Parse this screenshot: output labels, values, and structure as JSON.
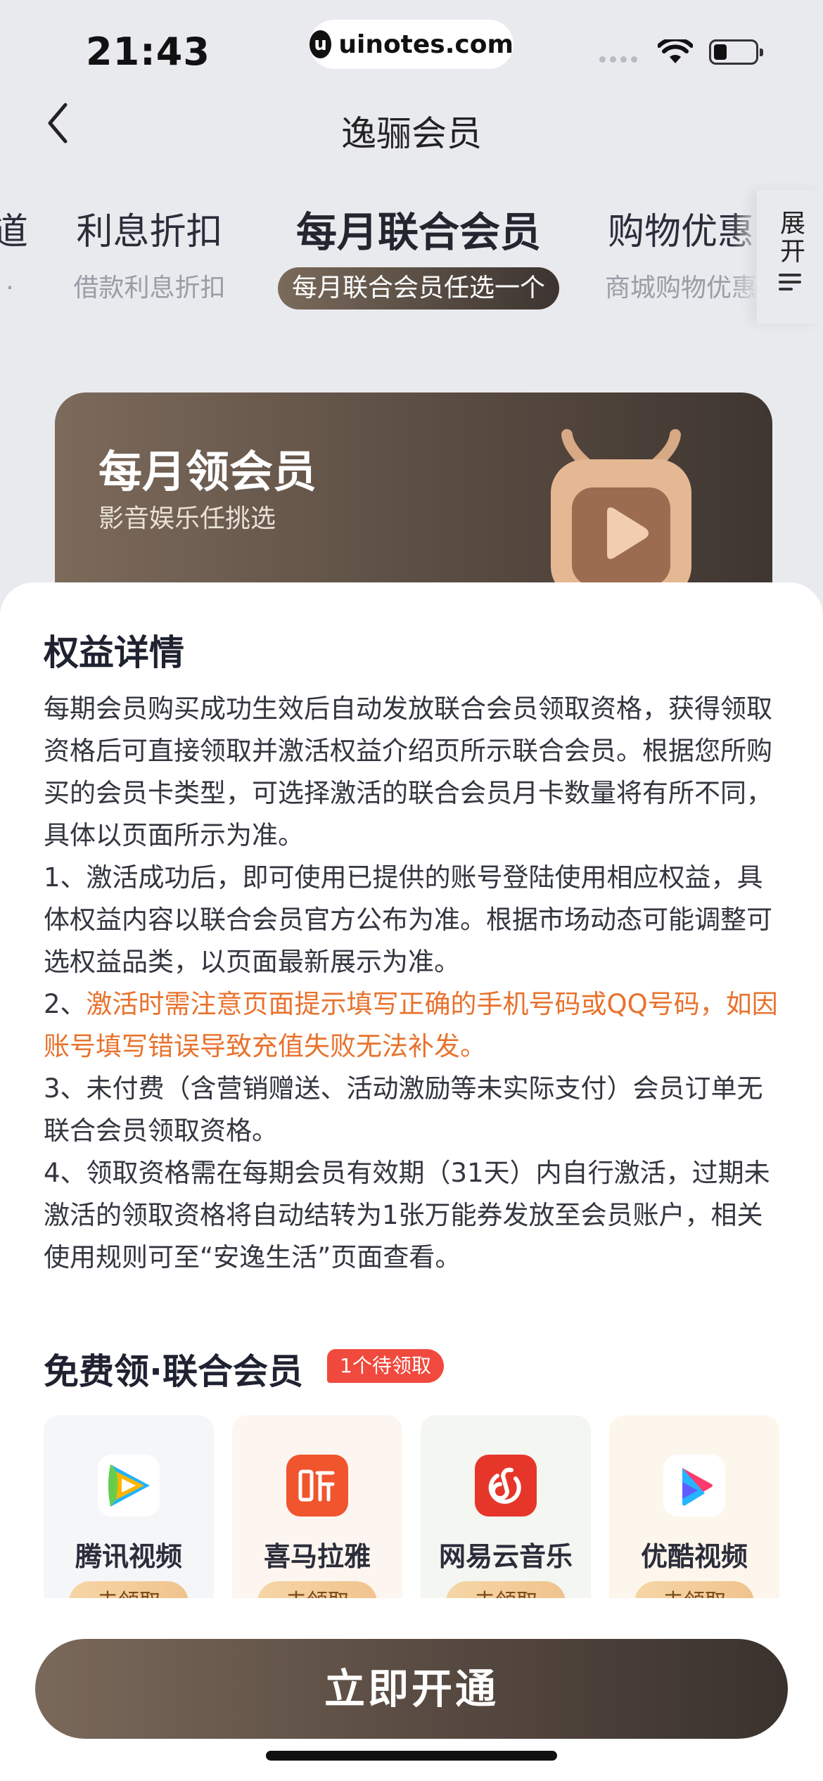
{
  "status_bar": {
    "time": "21:43",
    "url": "uinotes.com",
    "url_logo_glyph": "u"
  },
  "nav": {
    "title": "逸骊会员",
    "back_icon": "chevron-left-icon"
  },
  "tabs": [
    {
      "label": "道",
      "sub": "",
      "active": false
    },
    {
      "label": "利息折扣",
      "sub": "借款利息折扣",
      "active": false
    },
    {
      "label": "每月联合会员",
      "sub": "每月联合会员任选一个",
      "active": true
    },
    {
      "label": "购物优惠",
      "sub": "商城购物优惠",
      "active": false
    }
  ],
  "expand": {
    "label": "展开",
    "icon": "menu-icon"
  },
  "banner": {
    "title": "每月领会员",
    "subtitle": "影音娱乐任挑选",
    "art": "tv-play-icon"
  },
  "details": {
    "title": "权益详情",
    "paragraphs": [
      {
        "text": "每期会员购买成功生效后自动发放联合会员领取资格，获得领取资格后可直接领取并激活权益介绍页所示联合会员。根据您所购买的会员卡类型，可选择激活的联合会员月卡数量将有所不同，具体以页面所示为准。"
      },
      {
        "text": "1、激活成功后，即可使用已提供的账号登陆使用相应权益，具体权益内容以联合会员官方公布为准。根据市场动态可能调整可选权益品类，以页面最新展示为准。"
      },
      {
        "prefix": "2、",
        "highlight": "激活时需注意页面提示填写正确的手机号码或QQ号码，如因账号填写错误导致充值失败无法补发。"
      },
      {
        "text": "3、未付费（含营销赠送、活动激励等未实际支付）会员订单无联合会员领取资格。"
      },
      {
        "text": "4、领取资格需在每期会员有效期（31天）内自行激活，过期未激活的领取资格将自动结转为1张万能券发放至会员账户，相关使用规则可至“安逸生活”页面查看。"
      }
    ]
  },
  "free_section": {
    "title": "免费领·联合会员",
    "badge": "1个待领取",
    "cards": [
      {
        "name": "腾讯视频",
        "icon": "tencent-video-icon",
        "button": "去领取",
        "bg": "#f5f6f8"
      },
      {
        "name": "喜马拉雅",
        "icon": "ximalaya-icon",
        "button": "去领取",
        "bg": "#fdf5ef"
      },
      {
        "name": "网易云音乐",
        "icon": "netease-music-icon",
        "button": "去领取",
        "bg": "#f3f6f1"
      },
      {
        "name": "优酷视频",
        "icon": "youku-icon",
        "button": "去领取",
        "bg": "#fdf6ec"
      }
    ]
  },
  "cta": {
    "label": "立即开通"
  },
  "colors": {
    "accent_orange": "#e8722d",
    "badge_red": "#f04a3e",
    "brand_dark": "#3c3430"
  }
}
